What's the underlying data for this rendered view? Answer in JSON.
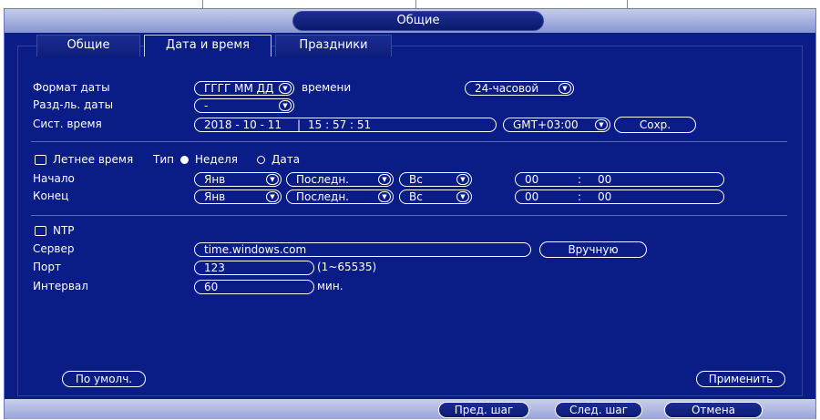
{
  "window": {
    "title": "Общие"
  },
  "tabs": [
    {
      "label": "Общие",
      "active": false
    },
    {
      "label": "Дата и время",
      "active": true
    },
    {
      "label": "Праздники",
      "active": false
    }
  ],
  "datetime": {
    "date_format_label": "Формат даты",
    "date_format_value": "ГГГГ ММ ДД",
    "time_format_label": "времени",
    "time_format_value": "24-часовой",
    "date_separator_label": "Разд-ль. даты",
    "date_separator_value": "-",
    "system_time_label": "Сист. время",
    "system_date": "2018 - 10 - 11",
    "system_time": "15 : 57 : 51",
    "timezone": "GMT+03:00",
    "save_label": "Сохр."
  },
  "dst": {
    "checkbox_label": "Летнее время",
    "type_label": "Тип",
    "option_week": "Неделя",
    "option_date": "Дата",
    "selected": "Неделя",
    "start_label": "Начало",
    "end_label": "Конец",
    "start": {
      "month": "Янв",
      "week": "Последн.",
      "day": "Вс",
      "hour": "00",
      "sep": ":",
      "minute": "00"
    },
    "end": {
      "month": "Янв",
      "week": "Последн.",
      "day": "Вс",
      "hour": "00",
      "sep": ":",
      "minute": "00"
    }
  },
  "ntp": {
    "checkbox_label": "NTP",
    "server_label": "Сервер",
    "server_value": "time.windows.com",
    "manual_label": "Вручную",
    "port_label": "Порт",
    "port_value": "123",
    "port_range": "(1~65535)",
    "interval_label": "Интервал",
    "interval_value": "60",
    "interval_unit": "мин."
  },
  "buttons": {
    "default_label": "По умолч.",
    "apply_label": "Применить",
    "prev_label": "Пред. шаг",
    "next_label": "След. шаг",
    "cancel_label": "Отмена"
  },
  "colors": {
    "background": "#0a1c86",
    "title_bar": "#9aa5d8",
    "text": "#ffffff"
  }
}
